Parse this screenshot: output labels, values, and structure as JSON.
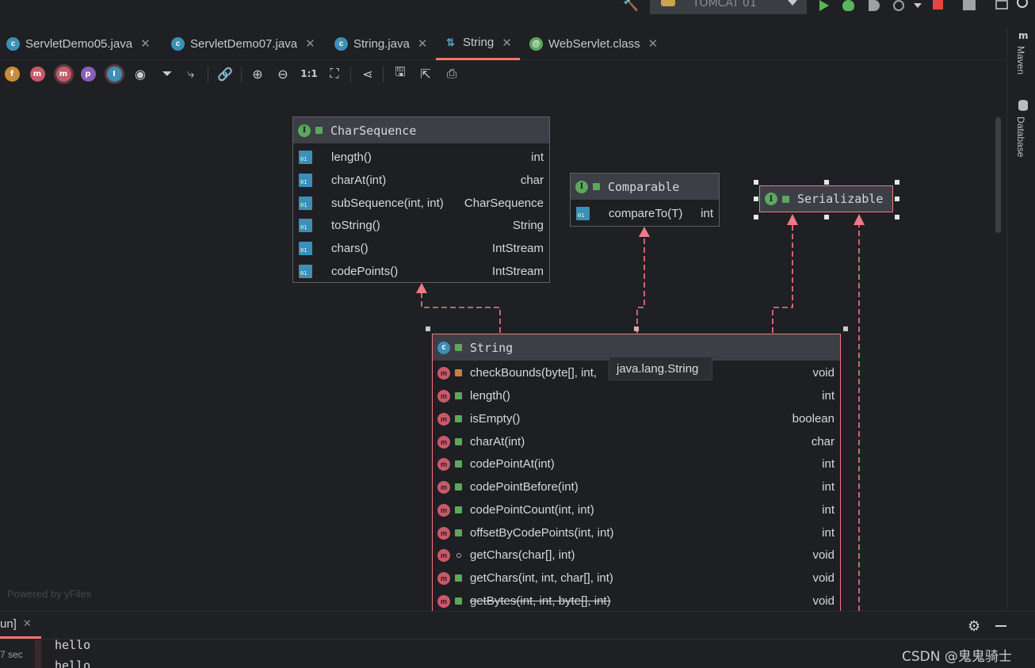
{
  "run": {
    "config_label": "TOMCAT 01"
  },
  "tabs": [
    {
      "label": "ServletDemo05.java",
      "icon": "class-icon"
    },
    {
      "label": "ServletDemo07.java",
      "icon": "class-icon"
    },
    {
      "label": "String.java",
      "icon": "class-icon"
    },
    {
      "label": "String",
      "icon": "diagram-icon",
      "active": true
    },
    {
      "label": "WebServlet.class",
      "icon": "annotation-icon"
    }
  ],
  "toolbar": {
    "zoom_actual": "1:1"
  },
  "right_stripe": {
    "maven": "Maven",
    "database": "Database"
  },
  "diagram": {
    "charsequence": {
      "title": "CharSequence",
      "members": [
        {
          "name": "length()",
          "ret": "int"
        },
        {
          "name": "charAt(int)",
          "ret": "char"
        },
        {
          "name": "subSequence(int, int)",
          "ret": "CharSequence"
        },
        {
          "name": "toString()",
          "ret": "String"
        },
        {
          "name": "chars()",
          "ret": "IntStream"
        },
        {
          "name": "codePoints()",
          "ret": "IntStream"
        }
      ]
    },
    "comparable": {
      "title": "Comparable",
      "members": [
        {
          "name": "compareTo(T)",
          "ret": "int"
        }
      ]
    },
    "serializable": {
      "title": "Serializable"
    },
    "string": {
      "title": "String",
      "tooltip": "java.lang.String",
      "members": [
        {
          "name": "checkBounds(byte[], int,",
          "ret": "void"
        },
        {
          "name": "length()",
          "ret": "int"
        },
        {
          "name": "isEmpty()",
          "ret": "boolean"
        },
        {
          "name": "charAt(int)",
          "ret": "char"
        },
        {
          "name": "codePointAt(int)",
          "ret": "int"
        },
        {
          "name": "codePointBefore(int)",
          "ret": "int"
        },
        {
          "name": "codePointCount(int, int)",
          "ret": "int"
        },
        {
          "name": "offsetByCodePoints(int, int)",
          "ret": "int"
        },
        {
          "name": "getChars(char[], int)",
          "ret": "void"
        },
        {
          "name": "getChars(int, int, char[], int)",
          "ret": "void"
        },
        {
          "name": "getBytes(int, int, byte[], int)",
          "ret": "void"
        }
      ]
    },
    "watermark": "Powered by yFiles"
  },
  "bottom": {
    "tab_label": "un]",
    "elapsed": "7 sec",
    "console_lines": [
      "hello",
      "hello"
    ]
  },
  "csdn_watermark": "CSDN @鬼鬼骑士"
}
